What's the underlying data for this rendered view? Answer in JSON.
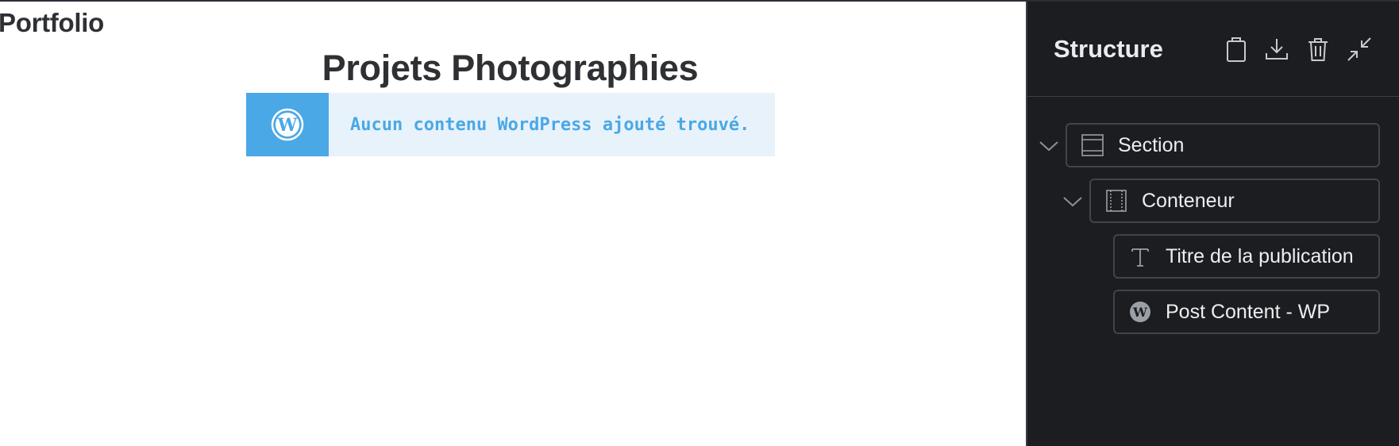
{
  "canvas": {
    "site_title": "Portfolio",
    "page_heading": "Projets Photographies",
    "notice": {
      "icon": "wordpress-icon",
      "text": "Aucun contenu WordPress ajouté trouvé."
    }
  },
  "panel": {
    "title": "Structure",
    "actions": [
      {
        "icon": "clipboard-icon"
      },
      {
        "icon": "download-icon"
      },
      {
        "icon": "trash-icon"
      },
      {
        "icon": "collapse-icon"
      }
    ],
    "tree": [
      {
        "label": "Section",
        "icon": "section-icon",
        "expanded": true
      },
      {
        "label": "Conteneur",
        "icon": "container-icon",
        "expanded": true
      },
      {
        "label": "Titre de la publication",
        "icon": "text-icon"
      },
      {
        "label": "Post Content - WP",
        "icon": "wordpress-icon"
      }
    ]
  },
  "colors": {
    "accent": "#4aa8e6",
    "notice_bg": "#e8f2fb",
    "panel_bg": "#1b1d20",
    "heading": "#2f3033"
  }
}
